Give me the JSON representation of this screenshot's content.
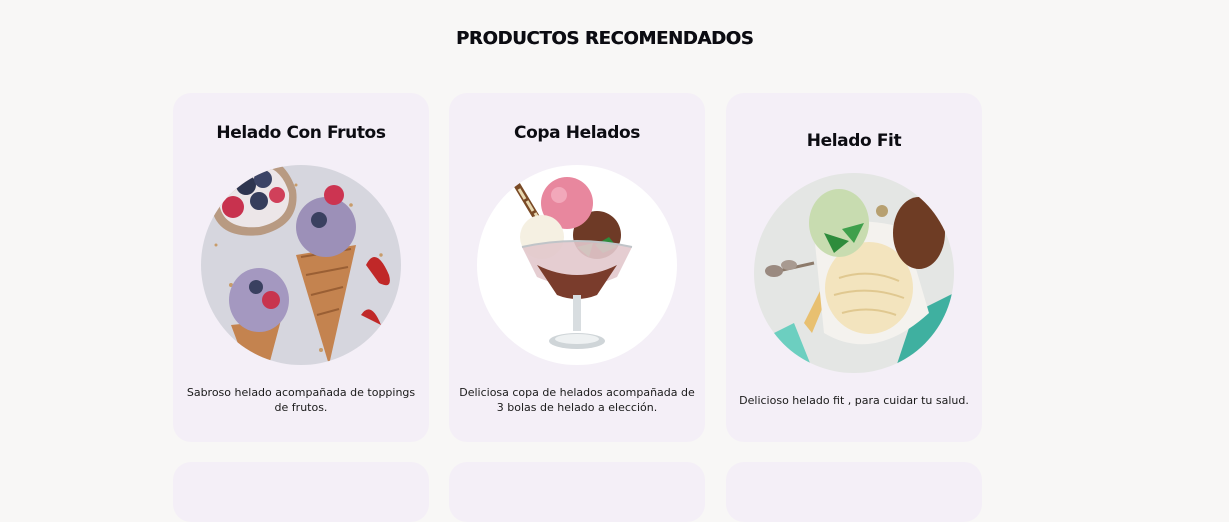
{
  "section": {
    "title": "PRODUCTOS RECOMENDADOS"
  },
  "products": [
    {
      "name": "Helado Con Frutos",
      "description": "Sabroso helado acompañada de toppings de frutos.",
      "image_icon": "ice-cream-cones-berries-image"
    },
    {
      "name": "Copa Helados",
      "description": "Deliciosa copa de helados acompañada de 3 bolas de helado a elección.",
      "image_icon": "ice-cream-sundae-cup-image"
    },
    {
      "name": "Helado Fit",
      "description": "Delicioso helado fit , para cuidar tu salud.",
      "image_icon": "ice-cream-bowl-image"
    }
  ],
  "colors": {
    "page_background": "#f8f7f6",
    "card_background": "#f4eff7",
    "title_text": "#0c0c12"
  }
}
